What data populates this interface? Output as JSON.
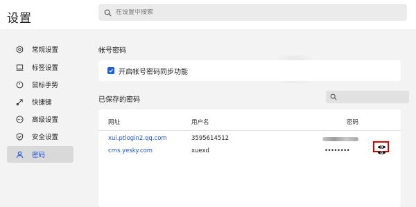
{
  "app": {
    "title": "设置"
  },
  "search": {
    "placeholder": "在设置中搜索"
  },
  "sidebar": {
    "items": [
      {
        "label": "常规设置",
        "icon": "gear-icon",
        "active": false
      },
      {
        "label": "标签设置",
        "icon": "tab-icon",
        "active": false
      },
      {
        "label": "鼠标手势",
        "icon": "mouse-icon",
        "active": false
      },
      {
        "label": "快捷键",
        "icon": "shortcut-arrow-icon",
        "active": false
      },
      {
        "label": "高级设置",
        "icon": "more-dots-icon",
        "active": false
      },
      {
        "label": "安全设置",
        "icon": "shield-icon",
        "active": false
      },
      {
        "label": "密码",
        "icon": "person-icon",
        "active": true
      }
    ]
  },
  "account": {
    "section_title": "帐号密码",
    "sync_label": "开启帐号密码同步功能",
    "sync_checked": true
  },
  "saved": {
    "section_title": "已保存的密码",
    "columns": {
      "site": "网址",
      "username": "用户名",
      "password": "密码"
    },
    "rows": [
      {
        "site": "xui.ptlogin2.qq.com",
        "username": "3595614512",
        "password_masked": "",
        "password_blurred": true
      },
      {
        "site": "cms.yesky.com",
        "username": "xuexd",
        "password_masked": "••••••••",
        "password_blurred": false
      }
    ]
  },
  "colors": {
    "accent": "#1a5fe0",
    "link": "#1a56c8",
    "highlight": "#d10000",
    "active_nav_bg": "#d9d9d9"
  }
}
